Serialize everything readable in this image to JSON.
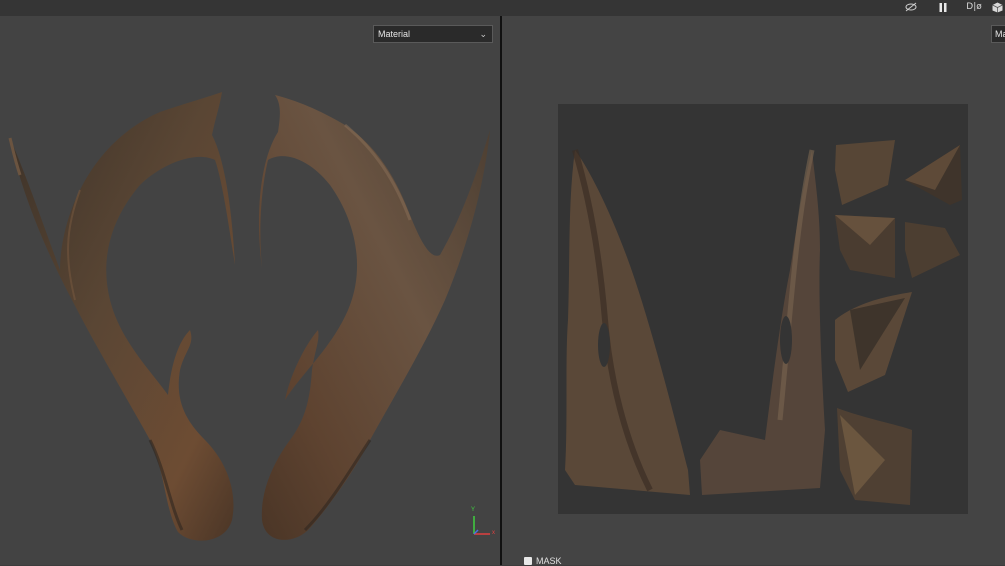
{
  "toolbar": {
    "icons": [
      "eye-off-icon",
      "pause-icon",
      "display-mode-icon",
      "cube-icon"
    ],
    "display_label": "D|ø"
  },
  "viewport3d": {
    "channel_dropdown": "Material",
    "axis_gizmo": {
      "y": "Y",
      "x": "x"
    }
  },
  "viewport2d": {
    "channel_dropdown": "Ma"
  },
  "layer_panel": {
    "mask_label": "MASK"
  },
  "colors": {
    "viewport_bg": "#434343",
    "uv_tile_bg": "#343434",
    "horn_base": "#4a3a2c",
    "horn_rust": "#6b4a30"
  }
}
